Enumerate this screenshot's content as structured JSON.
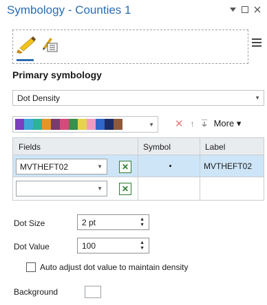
{
  "pane": {
    "title": "Symbology - Counties 1",
    "controls": {
      "dropdown_icon": "chevron-down-icon",
      "maximize_icon": "maximize-icon",
      "close_icon": "close-icon"
    }
  },
  "tabs": [
    {
      "icon": "paint-brush-icon"
    },
    {
      "icon": "symbol-properties-icon"
    }
  ],
  "menu_icon": "hamburger-menu-icon",
  "primary_symbology": {
    "heading": "Primary symbology",
    "selected": "Dot Density"
  },
  "color_scheme": {
    "colors": [
      "#7b3fbf",
      "#3ea8d8",
      "#2db39a",
      "#e8922a",
      "#7a3b6e",
      "#d64a7b",
      "#3a8f4a",
      "#e7d24f",
      "#f29bc0",
      "#3067c9",
      "#1e2c66",
      "#8e5a3c"
    ]
  },
  "toolbar": {
    "remove_icon": "remove-x-icon",
    "move_up_icon": "arrow-up-icon",
    "move_down_icon": "arrow-down-icon",
    "more_label": "More"
  },
  "table": {
    "headers": {
      "fields": "Fields",
      "symbol": "Symbol",
      "label": "Label"
    },
    "rows": [
      {
        "field": "MVTHEFT02",
        "label": "MVTHEFT02"
      },
      {
        "field": "",
        "label": ""
      }
    ]
  },
  "dot_size": {
    "label": "Dot Size",
    "value": "2 pt"
  },
  "dot_value": {
    "label": "Dot Value",
    "value": "100"
  },
  "auto_adjust": {
    "label": "Auto adjust dot value to maintain density",
    "checked": false
  },
  "background": {
    "label": "Background"
  }
}
